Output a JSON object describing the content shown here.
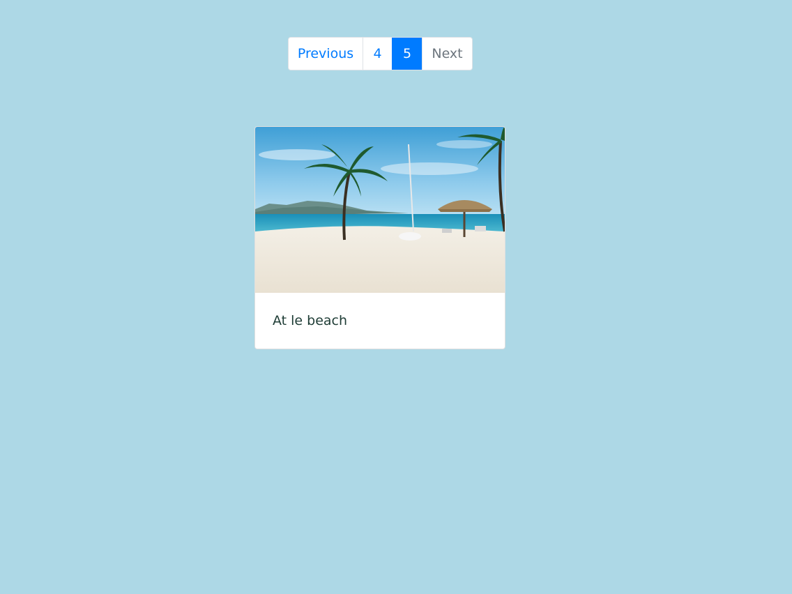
{
  "pagination": {
    "previous_label": "Previous",
    "pages": [
      "4",
      "5"
    ],
    "active_page": "5",
    "next_label": "Next"
  },
  "card": {
    "title": "At le beach",
    "image_icon": "beach-photo"
  },
  "colors": {
    "background": "#add8e6",
    "accent": "#007bff",
    "muted": "#6c757d",
    "card_text": "#1e3c35"
  }
}
